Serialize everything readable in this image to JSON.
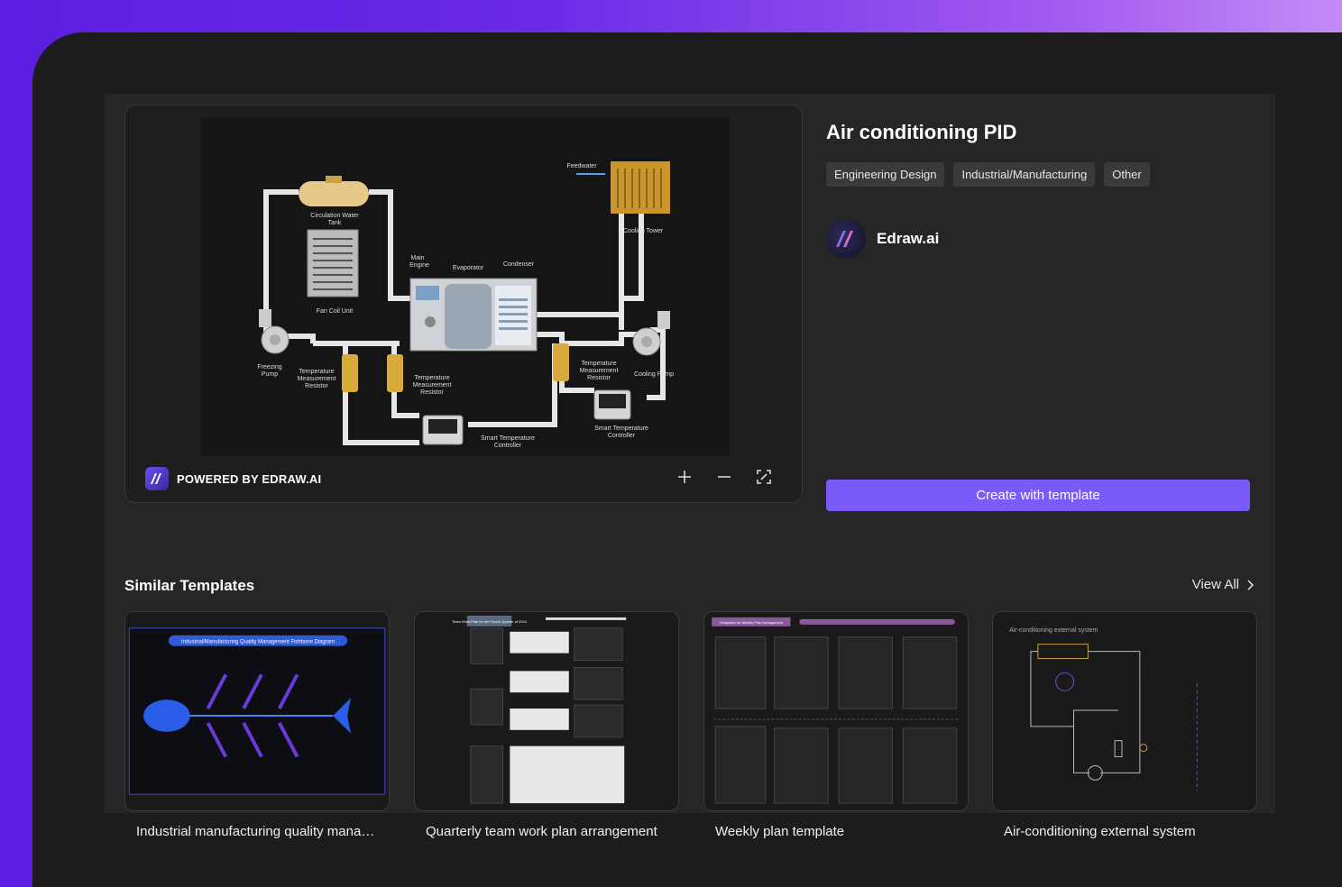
{
  "template": {
    "title": "Air conditioning PID",
    "tags": [
      "Engineering Design",
      "Industrial/Manufacturing",
      "Other"
    ],
    "author": "Edraw.ai",
    "create_label": "Create with template"
  },
  "preview": {
    "powered_by": "POWERED BY EDRAW.AI",
    "zoom_in_icon": "plus-icon",
    "zoom_out_icon": "minus-icon",
    "fullscreen_icon": "fullscreen-icon",
    "diagram_labels": {
      "feedwater": "Feedwater",
      "circulation_tank": "Circulation Water",
      "circulation_tank2": "Tank",
      "cooling_tower": "Cooling Tower",
      "main_engine": "Main",
      "main_engine2": "Engine",
      "evaporator": "Evaporator",
      "condenser": "Condenser",
      "fan_coil": "Fan Coil Unit",
      "freezing_pump": "Freezing",
      "freezing_pump2": "Pump",
      "temp_resistor_a": "Temperature",
      "temp_resistor_a2": "Measurement",
      "temp_resistor_a3": "Resistor",
      "temp_resistor_b": "Temperature",
      "temp_resistor_b2": "Measurement",
      "temp_resistor_b3": "Resistor",
      "temp_resistor_c": "Temperature",
      "temp_resistor_c2": "Measurement",
      "temp_resistor_c3": "Resistor",
      "cooling_pump": "Cooling Pump",
      "smart_ctrl_a": "Smart Temperature",
      "smart_ctrl_a2": "Controller",
      "smart_ctrl_b": "Smart Temperature",
      "smart_ctrl_b2": "Controller"
    }
  },
  "similar": {
    "title": "Similar Templates",
    "view_all": "View All",
    "cards": [
      {
        "label": "Industrial manufacturing quality management fishbone diagram",
        "thumb_title": "Industrial/Manufacturing Quality Management Fishbone Diagram"
      },
      {
        "label": "Quarterly team work plan arrangement",
        "thumb_title": "Team Work Plan for the Fourth Quarter of 2024"
      },
      {
        "label": "Weekly plan template",
        "thumb_title": "Templates for Weekly Plan Arrangement"
      },
      {
        "label": "Air-conditioning external system",
        "thumb_title": "Air-conditioning external system"
      }
    ]
  },
  "colors": {
    "accent": "#7a5af8",
    "pipe": "#e8e8e8",
    "brass": "#c9a24a"
  }
}
